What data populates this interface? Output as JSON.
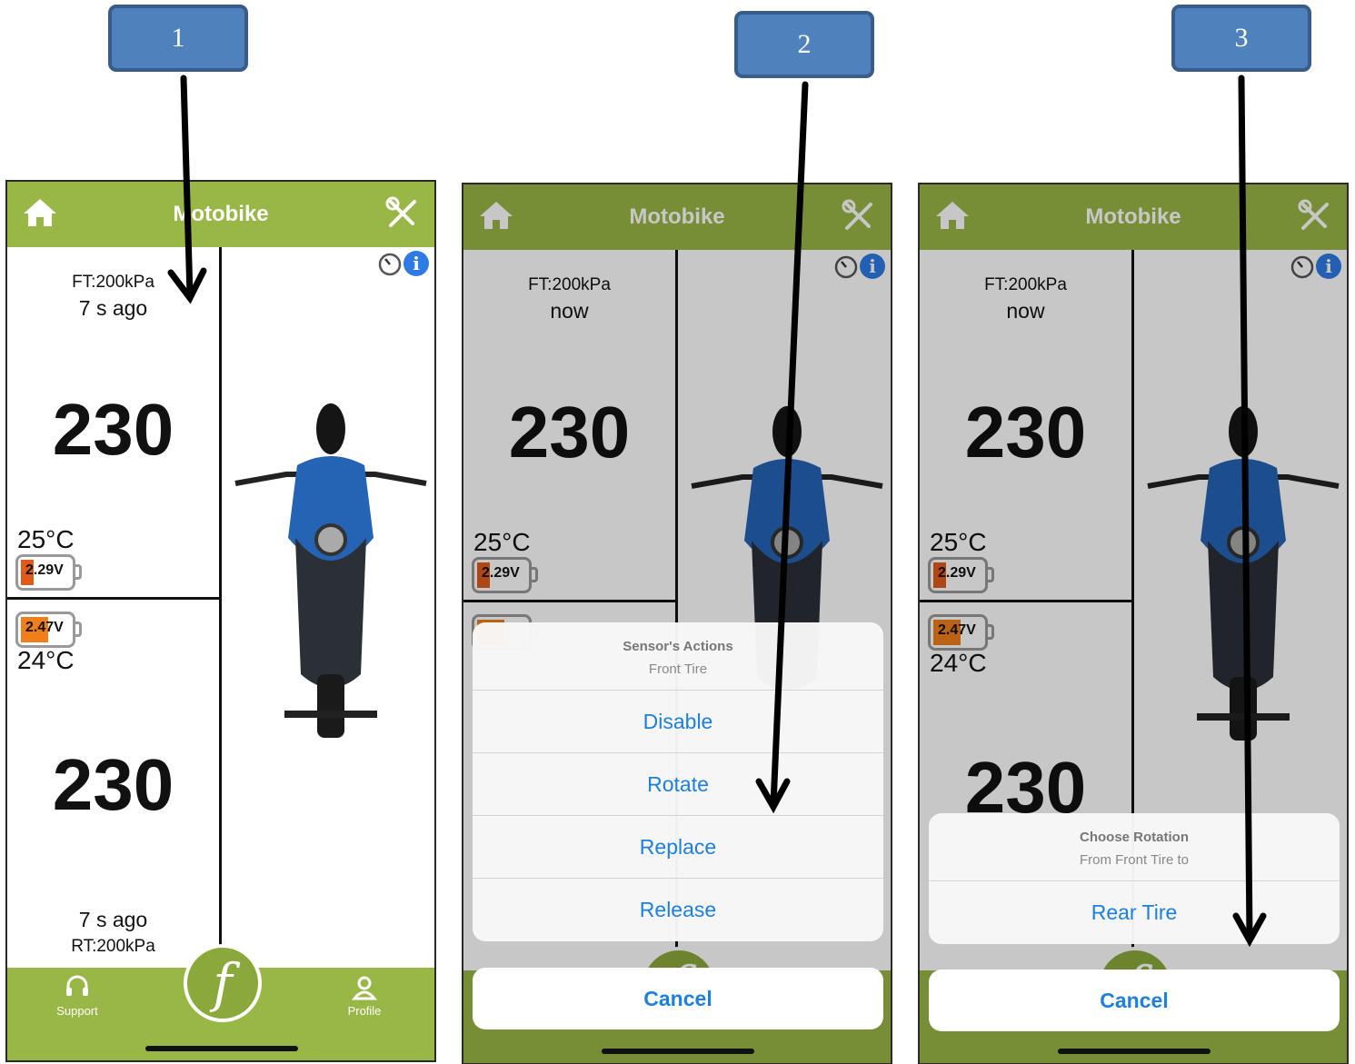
{
  "callouts": [
    "1",
    "2",
    "3"
  ],
  "app": {
    "title": "Motobike",
    "front": {
      "label": "FT:200kPa",
      "value": "230",
      "temp": "25°C",
      "volt": "2.29V"
    },
    "rear": {
      "label": "RT:200kPa",
      "value": "230",
      "temp": "24°C",
      "volt": "2.47V"
    },
    "colors": {
      "header": "#99b747",
      "accent_blue": "#1d7fe0",
      "battery_low": "#e05a1a",
      "battery_mid": "#f07f1a"
    }
  },
  "screens": [
    {
      "front_ago": "7 s ago",
      "rear_ago": "7 s ago"
    },
    {
      "front_ago": "now"
    },
    {
      "front_ago": "now"
    }
  ],
  "tabbar": {
    "support": "Support",
    "profile": "Profile",
    "center_logo": "f"
  },
  "sheet_actions": {
    "title": "Sensor's Actions",
    "subtitle": "Front Tire",
    "items": [
      "Disable",
      "Rotate",
      "Replace",
      "Release"
    ],
    "cancel": "Cancel"
  },
  "sheet_rotation": {
    "title": "Choose Rotation",
    "subtitle": "From Front Tire to",
    "items": [
      "Rear Tire"
    ],
    "cancel": "Cancel"
  }
}
